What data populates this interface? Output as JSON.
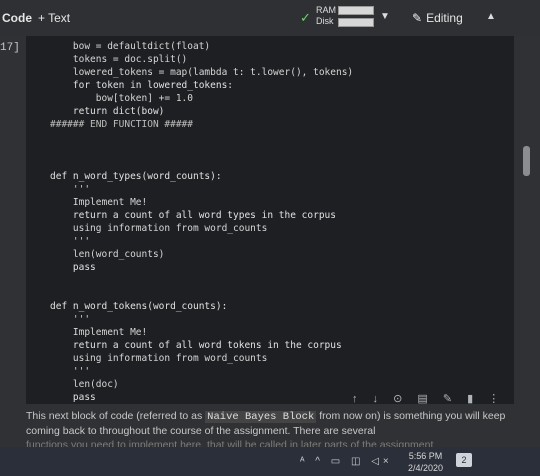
{
  "toolbar": {
    "code_label": "Code",
    "text_label": "+ Text",
    "ram_label": "RAM",
    "disk_label": "Disk",
    "editing_label": "Editing"
  },
  "cell": {
    "execution_count": "17]",
    "lines": [
      "    bow = defaultdict(float)",
      "    tokens = doc.split()",
      "    lowered_tokens = map(lambda t: t.lower(), tokens)",
      "    for token in lowered_tokens:",
      "        bow[token] += 1.0",
      "    return dict(bow)",
      "###### END FUNCTION #####",
      "",
      "",
      "",
      "def n_word_types(word_counts):",
      "    '''",
      "    Implement Me!",
      "    return a count of all word types in the corpus",
      "    using information from word_counts",
      "    '''",
      "    len(word_counts)",
      "    pass",
      "",
      "",
      "def n_word_tokens(word_counts):",
      "    '''",
      "    Implement Me!",
      "    return a count of all word tokens in the corpus",
      "    using information from word_counts",
      "    '''",
      "    len(doc)",
      "    pass"
    ]
  },
  "cell_tools": "↑ ↓ ⊙ ▤ ✎ ▮ ⋮",
  "markdown": {
    "before": "This next block of code (referred to as ",
    "inline": "Naive Bayes Block",
    "after": " from now on) is something you will keep coming back to throughout the course of the assignment. There are several",
    "fade": "functions you need to implement here, that will be called in later parts of the assignment"
  },
  "taskbar": {
    "tray_icons": "ᴬ ^ ▭ ◫ ◁×",
    "time": "5:56 PM",
    "date": "2/4/2020",
    "notification_count": "2"
  },
  "colors": {
    "toolbar_bg": "#2f3033",
    "cell_bg": "#1e1f22",
    "keyword": "#c792ea",
    "ok_check": "#6fd56f"
  }
}
